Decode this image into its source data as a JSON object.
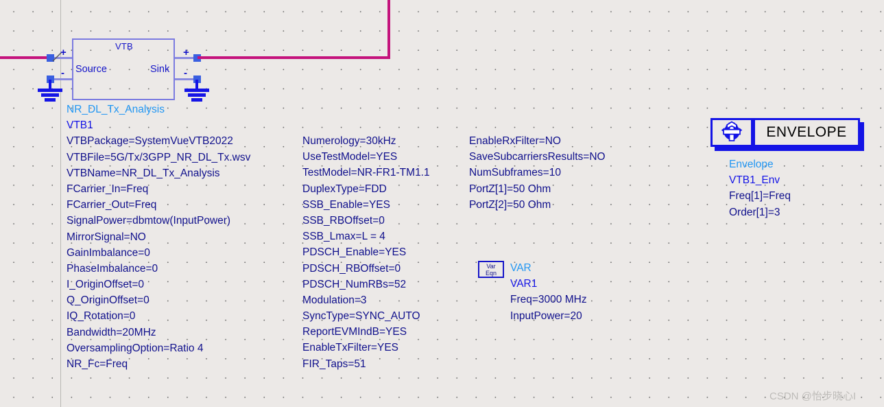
{
  "canvas": {
    "background_color": "#ece9e7",
    "grid_dot_color": "#6b6b6b",
    "guide_line_color": "#b9b7b4"
  },
  "colors": {
    "signal_wire": "#c4137c",
    "pin_wire": "#8a8ae0",
    "pin_marker": "#3a5fe0",
    "symbol_outline": "#7b7be0",
    "parameter_text": "#10108c",
    "instance_label": "#2196f3",
    "designator": "#1414e6",
    "block_border": "#1414e6",
    "envelope_title": "#000000"
  },
  "vtb_symbol": {
    "title": "VTB",
    "source_port_label": "Source",
    "sink_port_label": "Sink",
    "plus_sign": "+",
    "minus_sign": "-"
  },
  "vtb_component": {
    "instance_label": "NR_DL_Tx_Analysis",
    "designator": "VTB1",
    "columns": [
      {
        "name": "vtb-params-col-1",
        "lines": [
          "VTBPackage=SystemVueVTB2022",
          "VTBFile=5G/Tx/3GPP_NR_DL_Tx.wsv",
          "VTBName=NR_DL_Tx_Analysis",
          "FCarrier_In=Freq",
          "FCarrier_Out=Freq",
          "SignalPower=dbmtow(InputPower)",
          "MirrorSignal=NO",
          "GainImbalance=0",
          "PhaseImbalance=0",
          "I_OriginOffset=0",
          "Q_OriginOffset=0",
          "IQ_Rotation=0",
          "Bandwidth=20MHz",
          "OversamplingOption=Ratio 4",
          "NR_Fc=Freq"
        ]
      },
      {
        "name": "vtb-params-col-2",
        "lines": [
          "Numerology=30kHz",
          "UseTestModel=YES",
          "TestModel=NR-FR1-TM1.1",
          "DuplexType=FDD",
          "SSB_Enable=YES",
          "SSB_RBOffset=0",
          "SSB_Lmax=L = 4",
          "PDSCH_Enable=YES",
          "PDSCH_RBOffset=0",
          "PDSCH_NumRBs=52",
          "Modulation=3",
          "SyncType=SYNC_AUTO",
          "ReportEVMIndB=YES",
          "EnableTxFilter=YES",
          "FIR_Taps=51"
        ]
      },
      {
        "name": "vtb-params-col-3",
        "lines": [
          "EnableRxFilter=NO",
          "SaveSubcarriersResults=NO",
          "NumSubframes=10",
          "PortZ[1]=50 Ohm",
          "PortZ[2]=50 Ohm"
        ]
      }
    ]
  },
  "var_block": {
    "icon_line_1": "Var",
    "icon_line_2": "Eqn",
    "instance_label": "VAR",
    "designator": "VAR1",
    "lines": [
      "Freq=3000 MHz",
      "InputPower=20"
    ]
  },
  "envelope_block": {
    "icon_name": "gear-cog-icon",
    "title": "ENVELOPE",
    "instance_label": "Envelope",
    "designator": "VTB1_Env",
    "lines": [
      "Freq[1]=Freq",
      "Order[1]=3"
    ]
  },
  "watermark": {
    "text": "CSDN @怡步晓心I"
  }
}
